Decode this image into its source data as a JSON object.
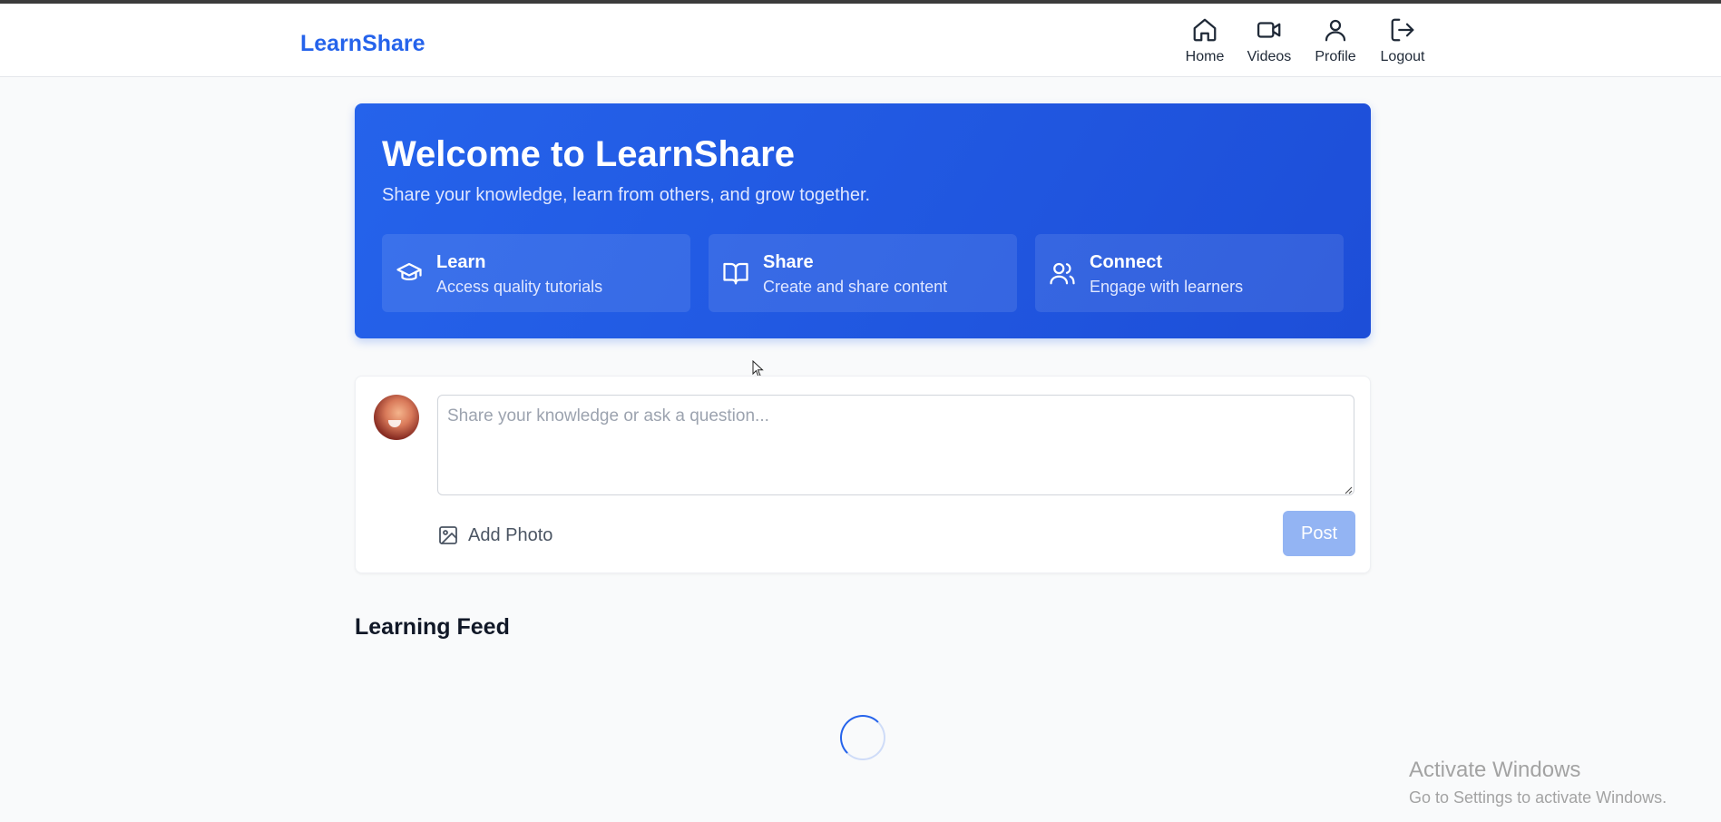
{
  "brand": {
    "name": "LearnShare",
    "color": "#2563eb"
  },
  "nav": {
    "items": [
      {
        "label": "Home",
        "icon": "home-icon"
      },
      {
        "label": "Videos",
        "icon": "video-icon"
      },
      {
        "label": "Profile",
        "icon": "user-icon"
      },
      {
        "label": "Logout",
        "icon": "logout-icon"
      }
    ]
  },
  "hero": {
    "title": "Welcome to LearnShare",
    "subtitle": "Share your knowledge, learn from others, and grow together.",
    "features": [
      {
        "title": "Learn",
        "desc": "Access quality tutorials",
        "icon": "graduation-cap-icon"
      },
      {
        "title": "Share",
        "desc": "Create and share content",
        "icon": "book-open-icon"
      },
      {
        "title": "Connect",
        "desc": "Engage with learners",
        "icon": "users-icon"
      }
    ],
    "gradient": [
      "#2563eb",
      "#1d4ed8"
    ]
  },
  "composer": {
    "placeholder": "Share your knowledge or ask a question...",
    "value": "",
    "add_photo_label": "Add Photo",
    "post_label": "Post",
    "post_color": "#93b4f3"
  },
  "feed": {
    "title": "Learning Feed",
    "loading": true
  },
  "watermark": {
    "line1": "Activate Windows",
    "line2": "Go to Settings to activate Windows."
  }
}
